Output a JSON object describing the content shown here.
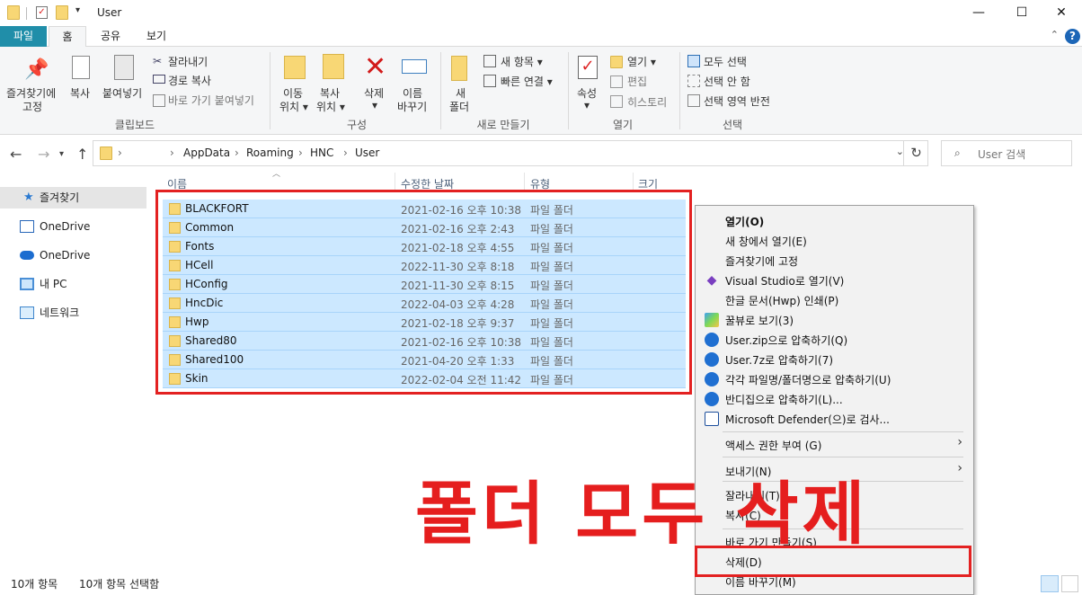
{
  "title": "User",
  "tabs": [
    "파일",
    "홈",
    "공유",
    "보기"
  ],
  "ribbon": {
    "pin_label1": "즐겨찾기에",
    "pin_label2": "고정",
    "copy": "복사",
    "paste": "붙여넣기",
    "cut": "잘라내기",
    "copy_path": "경로 복사",
    "paste_shortcut": "바로 가기 붙여넣기",
    "group_clipboard": "클립보드",
    "move1": "이동",
    "move2": "위치",
    "copyto1": "복사",
    "copyto2": "위치",
    "delete": "삭제",
    "rename1": "이름",
    "rename2": "바꾸기",
    "group_organize": "구성",
    "new_folder1": "새",
    "new_folder2": "폴더",
    "new_item": "새 항목",
    "easy_access": "빠른 연결",
    "group_new": "새로 만들기",
    "properties": "속성",
    "open": "열기",
    "edit": "편집",
    "history": "히스토리",
    "group_open": "열기",
    "select_all": "모두 선택",
    "select_none": "선택 안 함",
    "invert": "선택 영역 반전",
    "group_select": "선택"
  },
  "address": {
    "crumbs": [
      "AppData",
      "Roaming",
      "HNC",
      "User"
    ],
    "search_placeholder": "User 검색"
  },
  "nav": [
    "즐겨찾기",
    "OneDrive",
    "OneDrive",
    "내 PC",
    "네트워크"
  ],
  "columns": [
    "이름",
    "수정한 날짜",
    "유형",
    "크기"
  ],
  "files": [
    {
      "name": "BLACKFORT",
      "date": "2021-02-16 오후 10:38",
      "type": "파일 폴더"
    },
    {
      "name": "Common",
      "date": "2021-02-16 오후 2:43",
      "type": "파일 폴더"
    },
    {
      "name": "Fonts",
      "date": "2021-02-18 오후 4:55",
      "type": "파일 폴더"
    },
    {
      "name": "HCell",
      "date": "2022-11-30 오후 8:18",
      "type": "파일 폴더"
    },
    {
      "name": "HConfig",
      "date": "2021-11-30 오후 8:15",
      "type": "파일 폴더"
    },
    {
      "name": "HncDic",
      "date": "2022-04-03 오후 4:28",
      "type": "파일 폴더"
    },
    {
      "name": "Hwp",
      "date": "2021-02-18 오후 9:37",
      "type": "파일 폴더"
    },
    {
      "name": "Shared80",
      "date": "2021-02-16 오후 10:38",
      "type": "파일 폴더"
    },
    {
      "name": "Shared100",
      "date": "2021-04-20 오후 1:33",
      "type": "파일 폴더"
    },
    {
      "name": "Skin",
      "date": "2022-02-04 오전 11:42",
      "type": "파일 폴더"
    }
  ],
  "menu": {
    "open": "열기(O)",
    "open_new": "새 창에서 열기(E)",
    "pin_quick": "즐겨찾기에 고정",
    "vs": "Visual Studio로 열기(V)",
    "hwp_print": "한글 문서(Hwp) 인쇄(P)",
    "honeyview": "꿀뷰로 보기(3)",
    "zip": "User.zip으로 압축하기(Q)",
    "7z": "User.7z로 압축하기(7)",
    "each": "각각 파일명/폴더명으로 압축하기(U)",
    "bandizip": "반디집으로 압축하기(L)...",
    "defender": "Microsoft Defender(으)로 검사...",
    "access": "액세스 권한 부여 (G)",
    "sendto": "보내기(N)",
    "cut": "잘라내기(T)",
    "copy": "복사(C)",
    "shortcut": "바로 가기 만들기(S)",
    "delete": "삭제(D)",
    "rename": "이름 바꾸기(M)"
  },
  "overlay_text": "폴더 모두 삭제",
  "status": {
    "count": "10개 항목",
    "selected": "10개 항목 선택함"
  }
}
